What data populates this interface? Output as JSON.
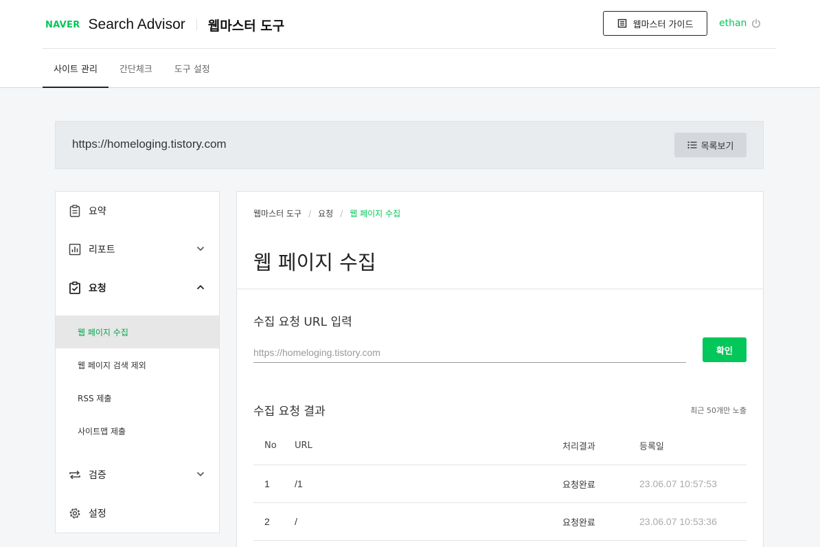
{
  "header": {
    "logo_text": "NAVER",
    "product_name": "Search Advisor",
    "tool_title": "웹마스터 도구",
    "guide_label": "웹마스터 가이드",
    "username": "ethan"
  },
  "tabs": [
    {
      "label": "사이트 관리",
      "active": true
    },
    {
      "label": "간단체크",
      "active": false
    },
    {
      "label": "도구 설정",
      "active": false
    }
  ],
  "site": {
    "url": "https://homeloging.tistory.com",
    "list_button_label": "목록보기"
  },
  "sidebar": {
    "items": [
      {
        "label": "요약",
        "icon": "clipboard-icon"
      },
      {
        "label": "리포트",
        "icon": "bar-chart-icon",
        "expanded": false
      },
      {
        "label": "요청",
        "icon": "clipboard-check-icon",
        "expanded": true
      },
      {
        "label": "검증",
        "icon": "repeat-icon",
        "expanded": false
      },
      {
        "label": "설정",
        "icon": "gear-icon"
      }
    ],
    "request_subitems": [
      {
        "label": "웹 페이지 수집",
        "active": true
      },
      {
        "label": "웹 페이지 검색 제외",
        "active": false
      },
      {
        "label": "RSS 제출",
        "active": false
      },
      {
        "label": "사이트맵 제출",
        "active": false
      }
    ]
  },
  "main": {
    "breadcrumb": [
      "웹마스터 도구",
      "요청",
      "웹 페이지 수집"
    ],
    "page_title": "웹 페이지 수집",
    "input_section_title": "수집 요청 URL 입력",
    "url_placeholder": "https://homeloging.tistory.com",
    "url_value": "",
    "confirm_label": "확인",
    "results_title": "수집 요청 결과",
    "results_note": "최근 50개만 노출",
    "columns": [
      "No",
      "URL",
      "처리결과",
      "등록일"
    ],
    "rows": [
      {
        "no": "1",
        "url": "/1",
        "result": "요청완료",
        "date": "23.06.07 10:57:53"
      },
      {
        "no": "2",
        "url": "/",
        "result": "요청완료",
        "date": "23.06.07 10:53:36"
      }
    ]
  },
  "colors": {
    "brand_green": "#03c75a",
    "site_bar_bg": "#e9ecef",
    "page_bg": "#f5f6f7"
  }
}
